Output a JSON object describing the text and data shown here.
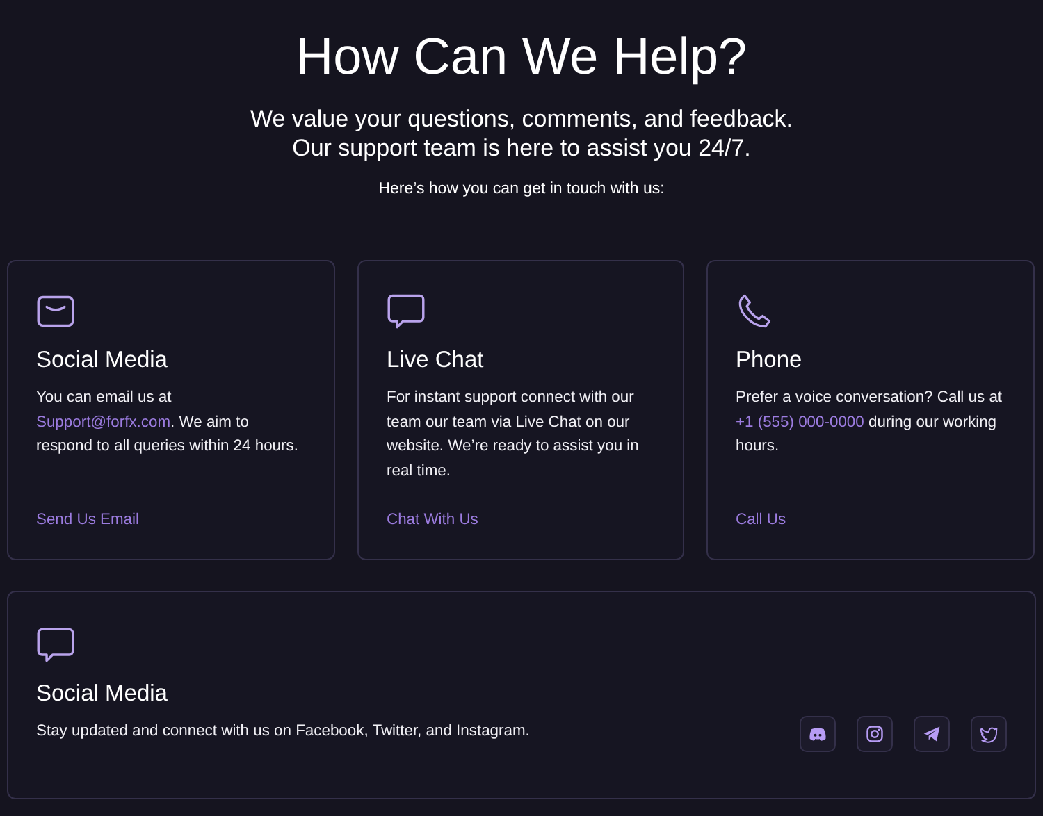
{
  "header": {
    "title": "How Can We Help?",
    "subtitle_lines": [
      "We value your questions, comments, and feedback.",
      "Our support team is here to assist you 24/7."
    ],
    "intro": "Here’s how you can get in touch with us:"
  },
  "cards": [
    {
      "kind": "mail",
      "title": "Social Media",
      "text_before": "You can email us at ",
      "link": "Support@forfx.com",
      "text_after": ". We aim to respond to all queries within 24 hours.",
      "action": "Send Us Email"
    },
    {
      "kind": "chat",
      "title": "Live Chat",
      "text_before": "For instant support connect with our team our team via Live Chat on our website. We’re ready to assist you in real time.",
      "action": "Chat With Us"
    },
    {
      "kind": "phone",
      "title": "Phone",
      "text_before": "Prefer a voice conversation? Call us at ",
      "link": "+1 (555) 000-0000",
      "text_after": " during our working hours.",
      "action": "Call Us"
    }
  ],
  "social": {
    "kind": "chat",
    "title": "Social Media",
    "text": "Stay updated and connect with us on Facebook, Twitter, and Instagram.",
    "buttons": [
      {
        "kind": "discord"
      },
      {
        "kind": "instagram"
      },
      {
        "kind": "telegram"
      },
      {
        "kind": "twitter"
      }
    ]
  }
}
